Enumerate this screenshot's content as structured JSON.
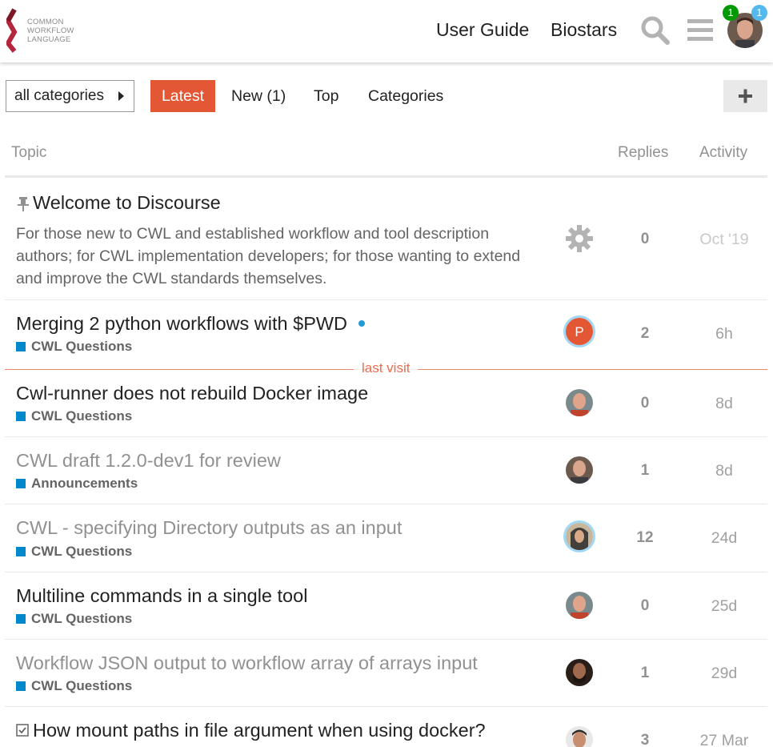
{
  "colors": {
    "accent": "#e45735",
    "category": "#0088cc",
    "badge_green": "#009900",
    "badge_blue": "#56b9ee"
  },
  "header": {
    "logo_lines": [
      "COMMON",
      "WORKFLOW",
      "LANGUAGE"
    ],
    "nav": {
      "user_guide": "User Guide",
      "biostars": "Biostars"
    },
    "icons": {
      "search": "search-icon",
      "menu": "hamburger-menu-icon"
    },
    "badges": {
      "notifications": "1",
      "messages": "1"
    }
  },
  "navbar": {
    "category_dropdown": "all categories",
    "latest": "Latest",
    "new": "New (1)",
    "top": "Top",
    "categories": "Categories",
    "plus_icon": "plus-icon"
  },
  "table": {
    "headers": {
      "topic": "Topic",
      "replies": "Replies",
      "activity": "Activity"
    },
    "last_visit_label": "last visit",
    "topics": [
      {
        "title": "Welcome to Discourse",
        "pinned": true,
        "excerpt": "For those new to CWL and established workflow and tool description authors; for CWL implementation developers; for those wanting to extend and improve the CWL standards themselves.",
        "poster": "gear-icon",
        "replies": "0",
        "activity": "Oct '19"
      },
      {
        "title": "Merging 2 python workflows with $PWD",
        "category": "CWL Questions",
        "poster_letter": "P",
        "replies": "2",
        "activity": "6h"
      },
      {
        "title": "Cwl-runner does not rebuild Docker image",
        "category": "CWL Questions",
        "replies": "0",
        "activity": "8d"
      },
      {
        "title": "CWL draft 1.2.0-dev1 for review",
        "category": "Announcements",
        "replies": "1",
        "activity": "8d"
      },
      {
        "title": "CWL - specifying Directory outputs as an input",
        "category": "CWL Questions",
        "replies": "12",
        "activity": "24d"
      },
      {
        "title": "Multiline commands in a single tool",
        "category": "CWL Questions",
        "replies": "0",
        "activity": "25d"
      },
      {
        "title": "Workflow JSON output to workflow array of arrays input",
        "category": "CWL Questions",
        "replies": "1",
        "activity": "29d"
      },
      {
        "title": "How mount paths in file argument when using docker?",
        "solved": true,
        "replies": "3",
        "activity": "27 Mar"
      }
    ]
  }
}
